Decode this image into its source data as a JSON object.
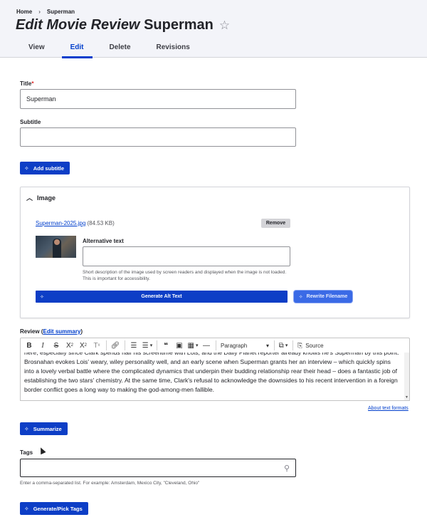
{
  "breadcrumb": {
    "home": "Home",
    "separator": "›",
    "current": "Superman"
  },
  "page": {
    "title_prefix": "Edit Movie Review",
    "title_name": "Superman",
    "star_icon": "☆"
  },
  "tabs": [
    {
      "label": "View"
    },
    {
      "label": "Edit",
      "active": true
    },
    {
      "label": "Delete"
    },
    {
      "label": "Revisions"
    }
  ],
  "fields": {
    "title": {
      "label": "Title",
      "required_mark": "*",
      "value": "Superman"
    },
    "subtitle": {
      "label": "Subtitle",
      "value": ""
    },
    "add_subtitle_button": "Add subtitle"
  },
  "image": {
    "summary": "Image",
    "file_name": "Superman-2025.jpg",
    "file_size": "(84.53 KB)",
    "remove_button": "Remove",
    "alt_label": "Alternative text",
    "alt_value": "",
    "alt_description": "Short description of the image used by screen readers and displayed when the image is not loaded. This is important for accessibility.",
    "generate_alt_button": "Generate Alt Text",
    "rewrite_filename_button": "Rewrite Filename"
  },
  "review": {
    "label": "Review",
    "open_paren": "(",
    "edit_summary_link": "Edit summary",
    "close_paren": ")",
    "toolbar": {
      "bold": "B",
      "italic": "I",
      "strike": "S",
      "superscript": "X",
      "superscript_mark": "2",
      "subscript": "X",
      "subscript_mark": "2",
      "remove_format": "T",
      "remove_format_mark": "x",
      "paragraph": "Paragraph",
      "source": "Source"
    },
    "text": "here, especially since Clark spends half his screentime with Lois, and the Daily Planet reporter already knows he's Superman by this point. Brosnahan evokes Lois' weary, wiley personality well, and an early scene when Superman grants her an interview – which quickly spins into a lovely verbal battle where the complicated dynamics that underpin their budding relationship rear their head – does a fantastic job of establishing the two stars' chemistry. At the same time, Clark's refusal to acknowledge the downsides to his recent intervention in a foreign border conflict goes a long way to making the god-among-men fallible.",
    "about_formats_link": "About text formats",
    "summarize_button": "Summarize"
  },
  "tags": {
    "label": "Tags",
    "value": "",
    "description": "Enter a comma-separated list. For example: Amsterdam, Mexico City, \"Cleveland, Ohio\"",
    "generate_button": "Generate/Pick Tags"
  },
  "colors": {
    "accent": "#003ecc",
    "button_blue": "#0d3ec6",
    "header_bg": "#f3f4f9"
  }
}
